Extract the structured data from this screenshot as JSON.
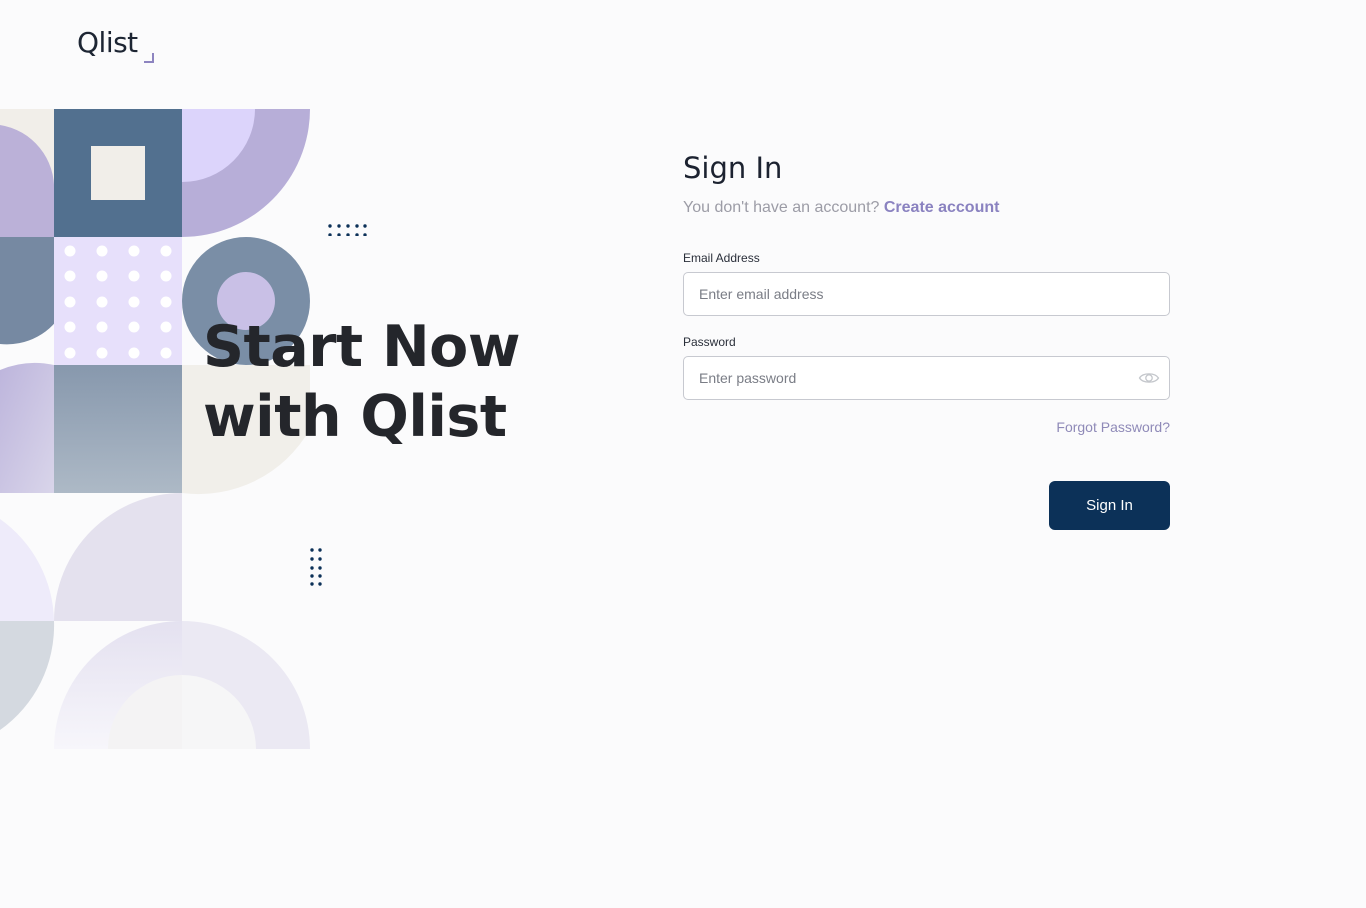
{
  "brand": {
    "logo_text": "Qlist",
    "accent_color": "#8d84c0"
  },
  "hero": {
    "line1": "Start Now",
    "line2": "with Qlist"
  },
  "signin": {
    "title": "Sign In",
    "subtitle_text": "You don't have an account?",
    "create_account_link": "Create account",
    "email_label": "Email Address",
    "email_placeholder": "Enter email address",
    "password_label": "Password",
    "password_placeholder": "Enter password",
    "forgot_link": "Forgot Password?",
    "submit_label": "Sign In",
    "button_color": "#0c3158"
  },
  "icons": {
    "password_toggle": "eye-icon"
  }
}
